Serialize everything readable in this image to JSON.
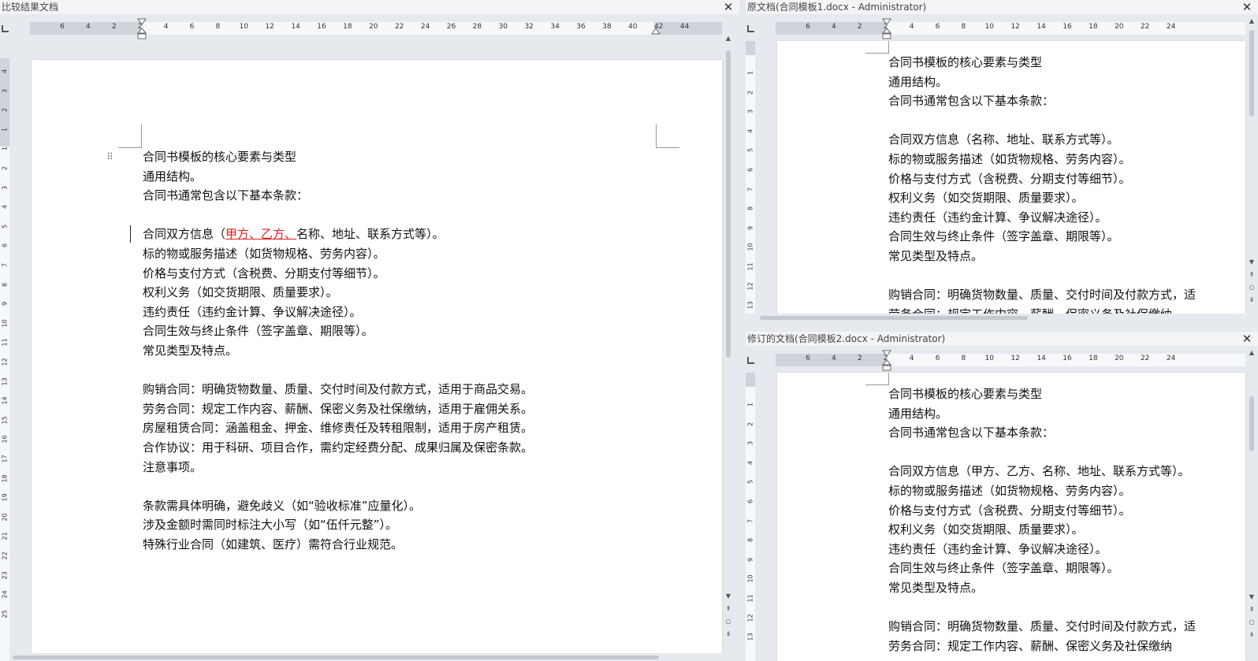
{
  "compare_pane": {
    "title": "比较结果文档",
    "close_label": "✕",
    "ruler_numbers": [
      "6",
      "4",
      "2",
      "2",
      "4",
      "6",
      "8",
      "10",
      "12",
      "14",
      "16",
      "18",
      "20",
      "22",
      "24",
      "26",
      "28",
      "30",
      "32",
      "34",
      "36",
      "38",
      "40",
      "42",
      "44"
    ],
    "vruler_numbers": [
      "4",
      "3",
      "2",
      "1",
      "1",
      "2",
      "3",
      "4",
      "5",
      "6",
      "7",
      "8",
      "9",
      "10",
      "11",
      "12",
      "13",
      "14",
      "15",
      "16",
      "17",
      "18",
      "19",
      "20",
      "21",
      "22",
      "23",
      "24",
      "25"
    ],
    "lines": [
      {
        "text": "合同书模板的核心要素与类型"
      },
      {
        "text": "通用结构。"
      },
      {
        "text": "合同书通常包含以下基本条款："
      },
      {
        "text": ""
      },
      {
        "pre": "合同双方信息（",
        "ins": "甲方、乙方、",
        "post": "名称、地址、联系方式等）。"
      },
      {
        "text": "标的物或服务描述（如货物规格、劳务内容）。"
      },
      {
        "text": "价格与支付方式（含税费、分期支付等细节）。"
      },
      {
        "text": "权利义务（如交货期限、质量要求）。"
      },
      {
        "text": "违约责任（违约金计算、争议解决途径）。"
      },
      {
        "text": "合同生效与终止条件（签字盖章、期限等）。"
      },
      {
        "text": "常见类型及特点。"
      },
      {
        "text": ""
      },
      {
        "text": "购销合同：明确货物数量、质量、交付时间及付款方式，适用于商品交易。"
      },
      {
        "text": "劳务合同：规定工作内容、薪酬、保密义务及社保缴纳，适用于雇佣关系。"
      },
      {
        "text": "房屋租赁合同：涵盖租金、押金、维修责任及转租限制，适用于房产租赁。"
      },
      {
        "text": "合作协议：用于科研、项目合作，需约定经费分配、成果归属及保密条款。"
      },
      {
        "text": "注意事项。"
      },
      {
        "text": ""
      },
      {
        "text": "条款需具体明确，避免歧义（如“验收标准”应量化）。"
      },
      {
        "text": "涉及金额时需同时标注大小写（如“伍仟元整”）。"
      },
      {
        "text": "特殊行业合同（如建筑、医疗）需符合行业规范。"
      }
    ],
    "insert_color": "#e02020"
  },
  "original_pane": {
    "title": "原文档(合同模板1.docx - Administrator)",
    "close_label": "✕",
    "ruler_numbers": [
      "6",
      "4",
      "2",
      "2",
      "4",
      "6",
      "8",
      "10",
      "12",
      "14",
      "16",
      "18",
      "20",
      "22",
      "24"
    ],
    "vruler_numbers": [
      "1",
      "2",
      "3",
      "4",
      "5",
      "6",
      "7",
      "8",
      "9",
      "10",
      "11",
      "12",
      "13"
    ],
    "lines": [
      "合同书模板的核心要素与类型",
      "通用结构。",
      "合同书通常包含以下基本条款：",
      "",
      "合同双方信息（名称、地址、联系方式等）。",
      "标的物或服务描述（如货物规格、劳务内容）。",
      "价格与支付方式（含税费、分期支付等细节）。",
      "权利义务（如交货期限、质量要求）。",
      "违约责任（违约金计算、争议解决途径）。",
      "合同生效与终止条件（签字盖章、期限等）。",
      "常见类型及特点。",
      "",
      "购销合同：明确货物数量、质量、交付时间及付款方式，适",
      "劳务合同：规定工作内容、薪酬、保密义务及社保缴纳"
    ]
  },
  "revised_pane": {
    "title": "修订的文档(合同模板2.docx - Administrator)",
    "close_label": "✕",
    "ruler_numbers": [
      "6",
      "4",
      "2",
      "2",
      "4",
      "6",
      "8",
      "10",
      "12",
      "14",
      "16",
      "18",
      "20",
      "22",
      "24"
    ],
    "vruler_numbers": [
      "1",
      "2",
      "3",
      "4",
      "5",
      "6",
      "7",
      "8",
      "9",
      "10",
      "11",
      "12",
      "13"
    ],
    "lines": [
      "合同书模板的核心要素与类型",
      "通用结构。",
      "合同书通常包含以下基本条款：",
      "",
      "合同双方信息（甲方、乙方、名称、地址、联系方式等）。",
      "标的物或服务描述（如货物规格、劳务内容）。",
      "价格与支付方式（含税费、分期支付等细节）。",
      "权利义务（如交货期限、质量要求）。",
      "违约责任（违约金计算、争议解决途径）。",
      "合同生效与终止条件（签字盖章、期限等）。",
      "常见类型及特点。",
      "",
      "购销合同：明确货物数量、质量、交付时间及付款方式，适",
      "劳务合同：规定工作内容、薪酬、保密义务及社保缴纳"
    ]
  }
}
